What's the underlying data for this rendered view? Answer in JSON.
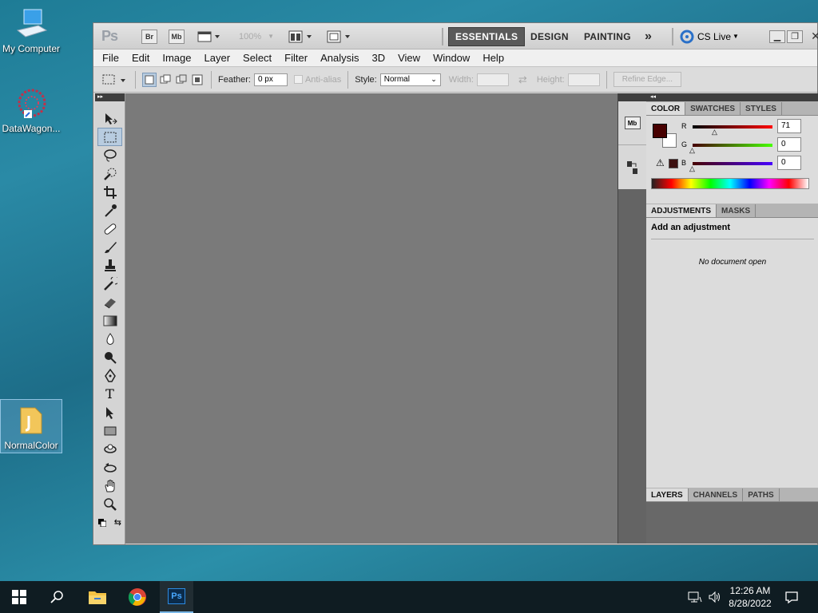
{
  "desktop": {
    "icons": [
      {
        "label": "My Computer"
      },
      {
        "label": "DataWagon..."
      },
      {
        "label": "NormalColor"
      }
    ]
  },
  "photoshop": {
    "logo": "Ps",
    "bridge_btn": "Br",
    "minibridge_btn": "Mb",
    "zoom_value": "100%",
    "workspaces": [
      "ESSENTIALS",
      "DESIGN",
      "PAINTING"
    ],
    "more_workspaces": "»",
    "cs_live": "CS Live",
    "menu": [
      "File",
      "Edit",
      "Image",
      "Layer",
      "Select",
      "Filter",
      "Analysis",
      "3D",
      "View",
      "Window",
      "Help"
    ],
    "options": {
      "feather_label": "Feather:",
      "feather_value": "0 px",
      "antialias_label": "Anti-alias",
      "style_label": "Style:",
      "style_value": "Normal",
      "width_label": "Width:",
      "height_label": "Height:",
      "refine_edge": "Refine Edge..."
    },
    "color_panel": {
      "tabs": [
        "COLOR",
        "SWATCHES",
        "STYLES"
      ],
      "foreground": "#470000",
      "background": "#ffffff",
      "r_label": "R",
      "g_label": "G",
      "b_label": "B",
      "r_value": "71",
      "g_value": "0",
      "b_value": "0"
    },
    "adjustments_panel": {
      "tabs": [
        "ADJUSTMENTS",
        "MASKS"
      ],
      "heading": "Add an adjustment",
      "empty_text": "No document open"
    },
    "layers_panel": {
      "tabs": [
        "LAYERS",
        "CHANNELS",
        "PATHS"
      ]
    }
  },
  "taskbar": {
    "time": "12:26 AM",
    "date": "8/28/2022",
    "ps_label": "Ps"
  }
}
